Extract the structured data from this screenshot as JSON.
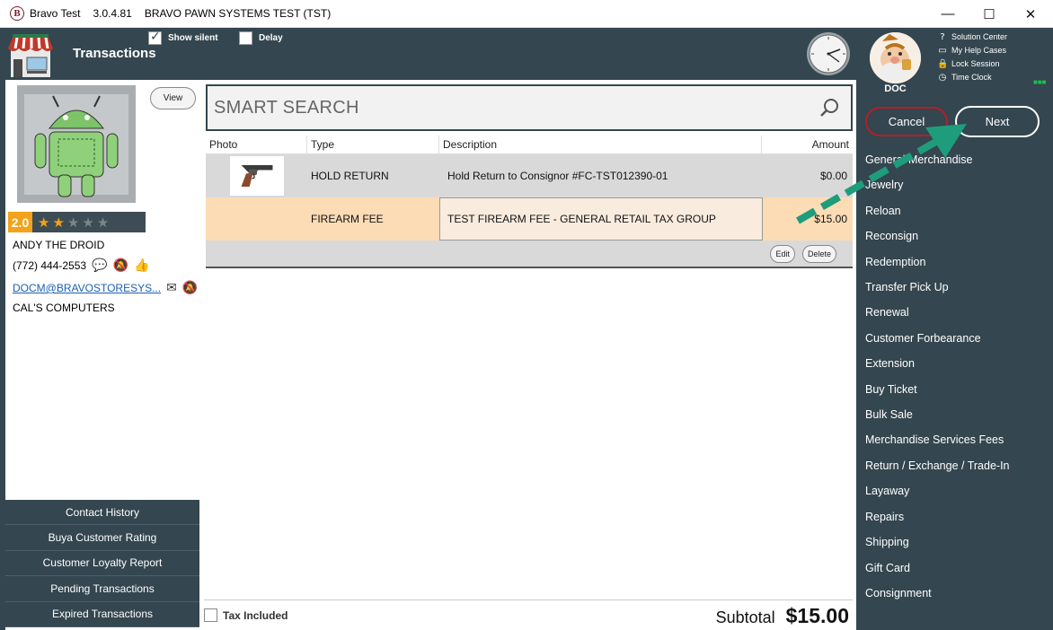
{
  "titlebar": {
    "app_name": "Bravo Test",
    "version": "3.0.4.81",
    "company": "BRAVO PAWN SYSTEMS TEST (TST)",
    "logo_letter": "B",
    "minimize": "—",
    "maximize": "☐",
    "close": "✕"
  },
  "header": {
    "title": "Transactions",
    "show_silent_label": "Show silent",
    "show_silent_checked": true,
    "delay_label": "Delay",
    "delay_checked": false
  },
  "user": {
    "name": "DOC",
    "links": [
      {
        "icon": "question-icon",
        "glyph": "?",
        "label": "Solution Center"
      },
      {
        "icon": "folder-icon",
        "glyph": "▭",
        "label": "My Help Cases"
      },
      {
        "icon": "lock-icon",
        "glyph": "🔒",
        "label": "Lock Session"
      },
      {
        "icon": "clock-icon",
        "glyph": "◷",
        "label": "Time Clock"
      }
    ],
    "indicator": "■■■"
  },
  "actions": {
    "cancel_label": "Cancel",
    "next_label": "Next"
  },
  "transaction_types": [
    "General Merchandise",
    "Jewelry",
    "Reloan",
    "Reconsign",
    "Redemption",
    "Transfer Pick Up",
    "Renewal",
    "Customer Forbearance",
    "Extension",
    "Buy Ticket",
    "Bulk Sale",
    "Merchandise Services Fees",
    "Return / Exchange / Trade-In",
    "Layaway",
    "Repairs",
    "Shipping",
    "Gift Card",
    "Consignment"
  ],
  "customer": {
    "view_label": "View",
    "rating": "2.0",
    "rating_value": 2,
    "rating_max": 5,
    "name": "ANDY THE DROID",
    "phone": "(772) 444-2553",
    "email": "DOCM@BRAVOSTORESYS...",
    "company": "CAL'S COMPUTERS"
  },
  "left_buttons": [
    "Contact History",
    "Buya Customer Rating",
    "Customer Loyalty Report",
    "Pending Transactions",
    "Expired Transactions"
  ],
  "search": {
    "placeholder": "SMART SEARCH"
  },
  "grid": {
    "columns": {
      "photo": "Photo",
      "type": "Type",
      "description": "Description",
      "amount": "Amount"
    },
    "rows": [
      {
        "type": "HOLD RETURN",
        "description": "Hold Return to Consignor #FC-TST012390-01",
        "amount": "$0.00"
      },
      {
        "type": "FIREARM FEE",
        "description": "TEST FIREARM FEE - GENERAL RETAIL TAX GROUP",
        "amount": "$15.00"
      }
    ],
    "edit_label": "Edit",
    "delete_label": "Delete"
  },
  "footer": {
    "tax_included_label": "Tax Included",
    "tax_included_checked": false,
    "subtotal_label": "Subtotal",
    "subtotal_amount": "$15.00"
  },
  "colors": {
    "panel": "#34464f",
    "accent": "#f2a31b",
    "selected_row": "#fcdcb5",
    "cancel_border": "#b51f27",
    "arrow": "#1f9c7c"
  }
}
